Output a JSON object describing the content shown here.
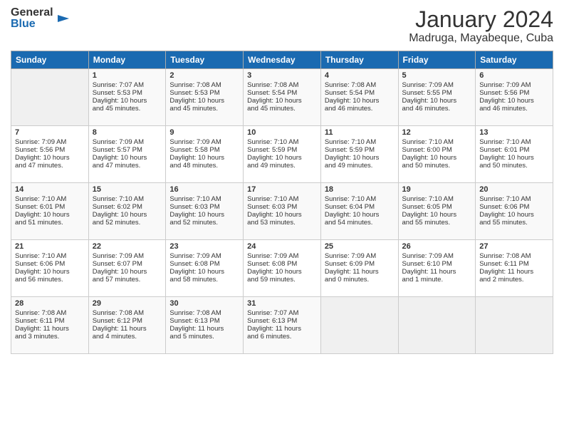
{
  "logo": {
    "line1": "General",
    "line2": "Blue"
  },
  "title": "January 2024",
  "location": "Madruga, Mayabeque, Cuba",
  "headers": [
    "Sunday",
    "Monday",
    "Tuesday",
    "Wednesday",
    "Thursday",
    "Friday",
    "Saturday"
  ],
  "weeks": [
    [
      {
        "day": "",
        "data": ""
      },
      {
        "day": "1",
        "data": "Sunrise: 7:07 AM\nSunset: 5:53 PM\nDaylight: 10 hours\nand 45 minutes."
      },
      {
        "day": "2",
        "data": "Sunrise: 7:08 AM\nSunset: 5:53 PM\nDaylight: 10 hours\nand 45 minutes."
      },
      {
        "day": "3",
        "data": "Sunrise: 7:08 AM\nSunset: 5:54 PM\nDaylight: 10 hours\nand 45 minutes."
      },
      {
        "day": "4",
        "data": "Sunrise: 7:08 AM\nSunset: 5:54 PM\nDaylight: 10 hours\nand 46 minutes."
      },
      {
        "day": "5",
        "data": "Sunrise: 7:09 AM\nSunset: 5:55 PM\nDaylight: 10 hours\nand 46 minutes."
      },
      {
        "day": "6",
        "data": "Sunrise: 7:09 AM\nSunset: 5:56 PM\nDaylight: 10 hours\nand 46 minutes."
      }
    ],
    [
      {
        "day": "7",
        "data": "Sunrise: 7:09 AM\nSunset: 5:56 PM\nDaylight: 10 hours\nand 47 minutes."
      },
      {
        "day": "8",
        "data": "Sunrise: 7:09 AM\nSunset: 5:57 PM\nDaylight: 10 hours\nand 47 minutes."
      },
      {
        "day": "9",
        "data": "Sunrise: 7:09 AM\nSunset: 5:58 PM\nDaylight: 10 hours\nand 48 minutes."
      },
      {
        "day": "10",
        "data": "Sunrise: 7:10 AM\nSunset: 5:59 PM\nDaylight: 10 hours\nand 49 minutes."
      },
      {
        "day": "11",
        "data": "Sunrise: 7:10 AM\nSunset: 5:59 PM\nDaylight: 10 hours\nand 49 minutes."
      },
      {
        "day": "12",
        "data": "Sunrise: 7:10 AM\nSunset: 6:00 PM\nDaylight: 10 hours\nand 50 minutes."
      },
      {
        "day": "13",
        "data": "Sunrise: 7:10 AM\nSunset: 6:01 PM\nDaylight: 10 hours\nand 50 minutes."
      }
    ],
    [
      {
        "day": "14",
        "data": "Sunrise: 7:10 AM\nSunset: 6:01 PM\nDaylight: 10 hours\nand 51 minutes."
      },
      {
        "day": "15",
        "data": "Sunrise: 7:10 AM\nSunset: 6:02 PM\nDaylight: 10 hours\nand 52 minutes."
      },
      {
        "day": "16",
        "data": "Sunrise: 7:10 AM\nSunset: 6:03 PM\nDaylight: 10 hours\nand 52 minutes."
      },
      {
        "day": "17",
        "data": "Sunrise: 7:10 AM\nSunset: 6:03 PM\nDaylight: 10 hours\nand 53 minutes."
      },
      {
        "day": "18",
        "data": "Sunrise: 7:10 AM\nSunset: 6:04 PM\nDaylight: 10 hours\nand 54 minutes."
      },
      {
        "day": "19",
        "data": "Sunrise: 7:10 AM\nSunset: 6:05 PM\nDaylight: 10 hours\nand 55 minutes."
      },
      {
        "day": "20",
        "data": "Sunrise: 7:10 AM\nSunset: 6:06 PM\nDaylight: 10 hours\nand 55 minutes."
      }
    ],
    [
      {
        "day": "21",
        "data": "Sunrise: 7:10 AM\nSunset: 6:06 PM\nDaylight: 10 hours\nand 56 minutes."
      },
      {
        "day": "22",
        "data": "Sunrise: 7:09 AM\nSunset: 6:07 PM\nDaylight: 10 hours\nand 57 minutes."
      },
      {
        "day": "23",
        "data": "Sunrise: 7:09 AM\nSunset: 6:08 PM\nDaylight: 10 hours\nand 58 minutes."
      },
      {
        "day": "24",
        "data": "Sunrise: 7:09 AM\nSunset: 6:08 PM\nDaylight: 10 hours\nand 59 minutes."
      },
      {
        "day": "25",
        "data": "Sunrise: 7:09 AM\nSunset: 6:09 PM\nDaylight: 11 hours\nand 0 minutes."
      },
      {
        "day": "26",
        "data": "Sunrise: 7:09 AM\nSunset: 6:10 PM\nDaylight: 11 hours\nand 1 minute."
      },
      {
        "day": "27",
        "data": "Sunrise: 7:08 AM\nSunset: 6:11 PM\nDaylight: 11 hours\nand 2 minutes."
      }
    ],
    [
      {
        "day": "28",
        "data": "Sunrise: 7:08 AM\nSunset: 6:11 PM\nDaylight: 11 hours\nand 3 minutes."
      },
      {
        "day": "29",
        "data": "Sunrise: 7:08 AM\nSunset: 6:12 PM\nDaylight: 11 hours\nand 4 minutes."
      },
      {
        "day": "30",
        "data": "Sunrise: 7:08 AM\nSunset: 6:13 PM\nDaylight: 11 hours\nand 5 minutes."
      },
      {
        "day": "31",
        "data": "Sunrise: 7:07 AM\nSunset: 6:13 PM\nDaylight: 11 hours\nand 6 minutes."
      },
      {
        "day": "",
        "data": ""
      },
      {
        "day": "",
        "data": ""
      },
      {
        "day": "",
        "data": ""
      }
    ]
  ]
}
